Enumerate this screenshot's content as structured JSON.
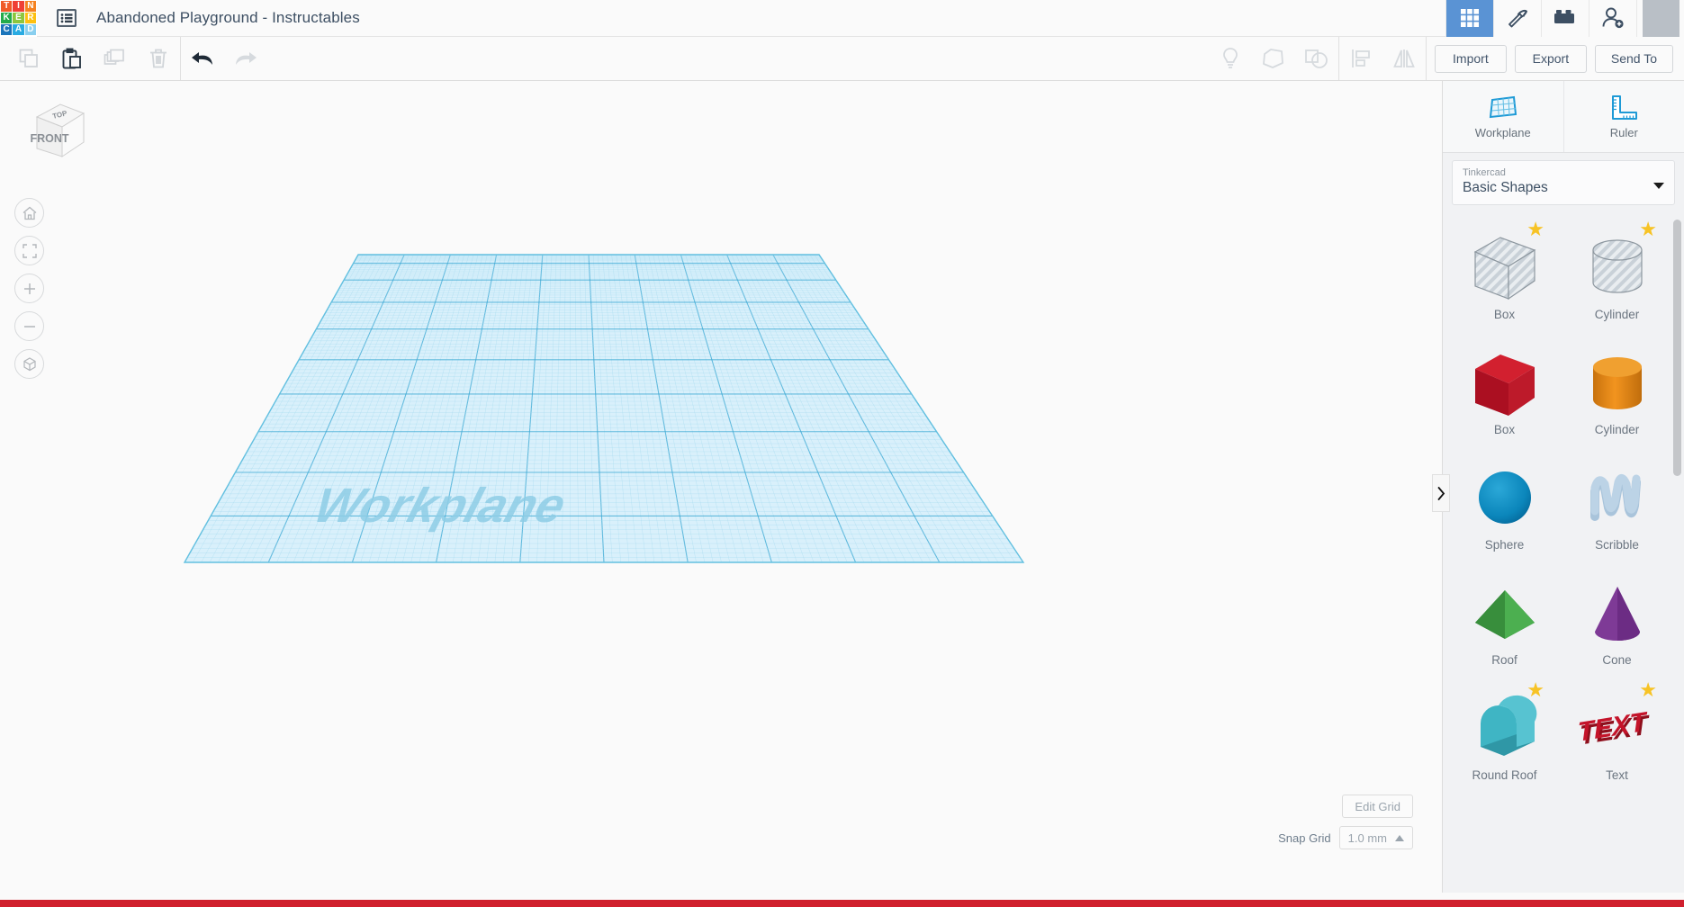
{
  "app": {
    "name": "Tinkercad",
    "logo_letters": [
      "T",
      "I",
      "N",
      "K",
      "E",
      "R",
      "C",
      "A",
      "D"
    ],
    "logo_colors": [
      "#f05a28",
      "#ef3f36",
      "#f58220",
      "#22ab4b",
      "#8cc63e",
      "#fdc010",
      "#1b75bb",
      "#29abe2",
      "#89cfef"
    ],
    "document_title": "Abandoned Playground - Instructables",
    "menu_icon": "list-menu-icon"
  },
  "topbar_right": [
    {
      "name": "gallery-grid-icon",
      "active": true
    },
    {
      "name": "pickaxe-icon",
      "active": false
    },
    {
      "name": "lego-brick-icon",
      "active": false
    },
    {
      "name": "add-person-icon",
      "active": false
    },
    {
      "name": "user-avatar",
      "active": false
    }
  ],
  "toolbar": {
    "left_tools": [
      {
        "label": "Copy",
        "icon": "copy-icon",
        "enabled": false
      },
      {
        "label": "Paste",
        "icon": "paste-icon",
        "enabled": true
      },
      {
        "label": "Duplicate",
        "icon": "duplicate-icon",
        "enabled": false
      },
      {
        "label": "Delete",
        "icon": "trash-icon",
        "enabled": false
      },
      {
        "label": "Undo",
        "icon": "undo-arrow-icon",
        "enabled": true
      },
      {
        "label": "Redo",
        "icon": "redo-arrow-icon",
        "enabled": false
      }
    ],
    "right_tools": [
      {
        "label": "Hint",
        "icon": "lightbulb-icon",
        "enabled": false
      },
      {
        "label": "Group",
        "icon": "group-icon",
        "enabled": false
      },
      {
        "label": "Ungroup",
        "icon": "ungroup-icon",
        "enabled": false
      },
      {
        "label": "Align",
        "icon": "align-icon",
        "enabled": false
      },
      {
        "label": "Mirror",
        "icon": "mirror-flip-icon",
        "enabled": false
      }
    ],
    "import_label": "Import",
    "export_label": "Export",
    "sendto_label": "Send To"
  },
  "canvas": {
    "viewcube": {
      "top_face": "TOP",
      "front_face": "FRONT"
    },
    "nav_buttons": [
      {
        "name": "home-view-button",
        "icon": "home-icon"
      },
      {
        "name": "fit-view-button",
        "icon": "fit-brackets-icon"
      },
      {
        "name": "zoom-in-button",
        "icon": "plus-icon"
      },
      {
        "name": "zoom-out-button",
        "icon": "minus-icon"
      },
      {
        "name": "perspective-toggle-button",
        "icon": "cube-perspective-icon"
      }
    ],
    "workplane_label": "Workplane",
    "grid_colors": {
      "fill": "#d9f0fa",
      "minor_line": "#9fd8ee",
      "major_line": "#3aa8d4",
      "label_text": "#8ecde6"
    },
    "edit_grid_label": "Edit Grid",
    "snap_grid_label": "Snap Grid",
    "snap_grid_value": "1.0 mm"
  },
  "panel": {
    "collapse_handle_icon": "chevron-right-icon",
    "tools": [
      {
        "label": "Workplane",
        "icon": "workplane-icon"
      },
      {
        "label": "Ruler",
        "icon": "ruler-icon"
      }
    ],
    "library": {
      "source_label": "Tinkercad",
      "selected": "Basic Shapes"
    },
    "shapes": [
      {
        "label": "Box",
        "art": "box-hole",
        "starred": true
      },
      {
        "label": "Cylinder",
        "art": "cylinder-hole",
        "starred": true
      },
      {
        "label": "Box",
        "art": "box-red",
        "starred": false
      },
      {
        "label": "Cylinder",
        "art": "cylinder-orange",
        "starred": false
      },
      {
        "label": "Sphere",
        "art": "sphere-blue",
        "starred": false
      },
      {
        "label": "Scribble",
        "art": "scribble",
        "starred": false
      },
      {
        "label": "Roof",
        "art": "roof-green",
        "starred": false
      },
      {
        "label": "Cone",
        "art": "cone-purple",
        "starred": false
      },
      {
        "label": "Round Roof",
        "art": "round-roof-teal",
        "starred": true
      },
      {
        "label": "Text",
        "art": "text-red",
        "starred": true
      }
    ]
  },
  "statusbar": {
    "accent_color": "#d0202e"
  }
}
